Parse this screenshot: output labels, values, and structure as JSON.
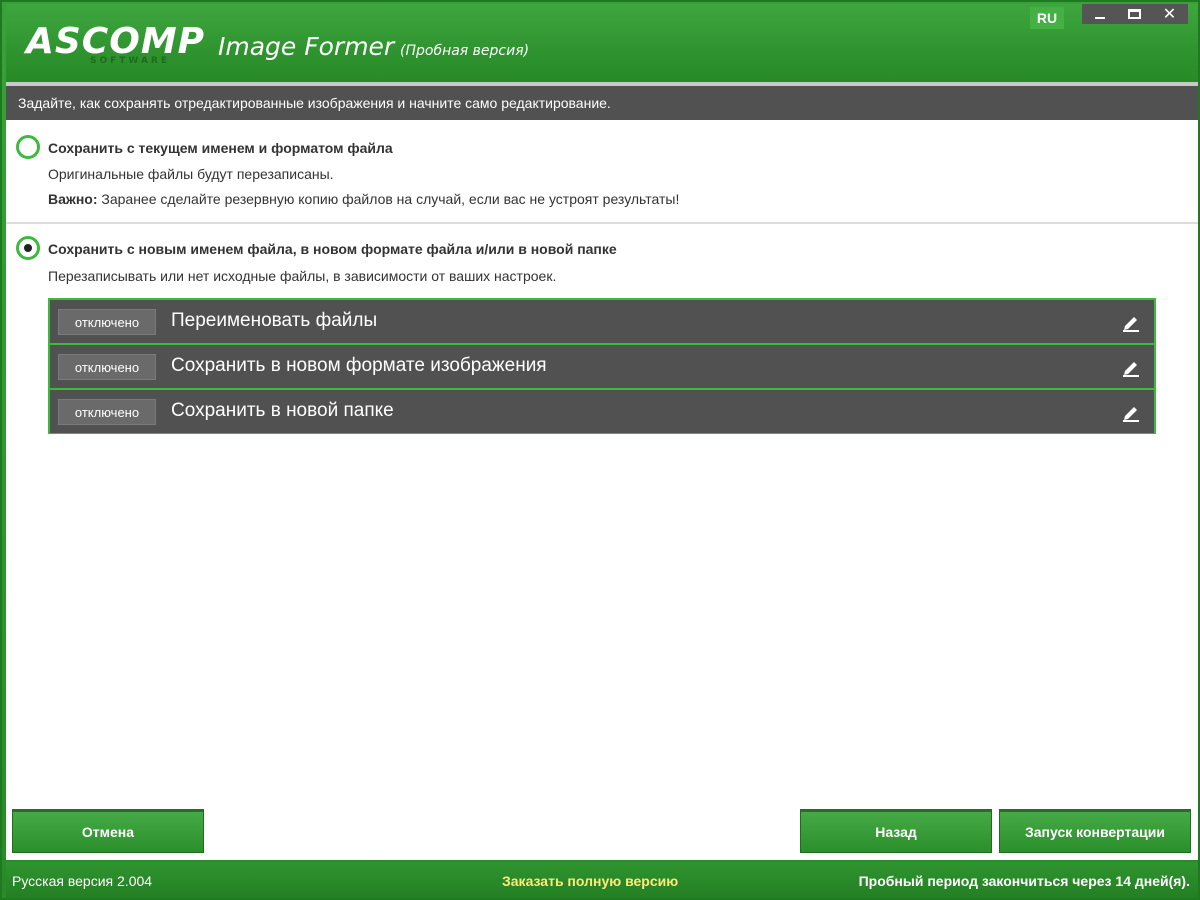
{
  "header": {
    "logo_text": "ASCOMP",
    "logo_sub": "SOFTWARE",
    "app_title": "Image Former",
    "trial_label": "(Пробная версия)",
    "lang": "RU",
    "controls": {
      "minimize": "minimize-icon",
      "maximize": "maximize-icon",
      "close": "✕"
    }
  },
  "instruction": "Задайте, как сохранять отредактированные изображения и начните само редактирование.",
  "option1": {
    "title": "Сохранить с текущем именем и форматом файла",
    "desc": "Оригинальные файлы будут перезаписаны.",
    "important_label": "Важно:",
    "important_text": "Заранее сделайте резервную копию файлов на случай, если вас не устроят результаты!",
    "selected": false
  },
  "option2": {
    "title": "Сохранить с новым именем файла, в новом формате файла и/или в новой папке",
    "desc": "Перезаписывать или нет исходные файлы, в зависимости от ваших настроек.",
    "selected": true,
    "rows": [
      {
        "toggle": "отключено",
        "label": "Переименовать файлы",
        "icon": "pencil-icon"
      },
      {
        "toggle": "отключено",
        "label": "Сохранить в новом формате изображения",
        "icon": "pencil-icon"
      },
      {
        "toggle": "отключено",
        "label": "Сохранить в новой папке",
        "icon": "pencil-icon"
      }
    ]
  },
  "buttons": {
    "cancel": "Отмена",
    "back": "Назад",
    "start": "Запуск конвертации"
  },
  "status": {
    "version": "Русская версия 2.004",
    "order": "Заказать полную версию",
    "trial": "Пробный период закончиться через 14 дней(я)."
  },
  "colors": {
    "accent_green": "#3cba3c",
    "dark_gray": "#515151",
    "status_yellow": "#ffe97a"
  }
}
